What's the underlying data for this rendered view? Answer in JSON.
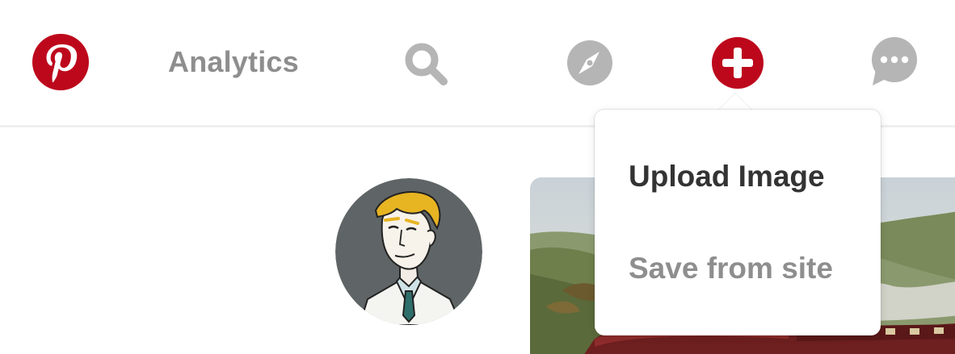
{
  "colors": {
    "brand_red": "#bd081c",
    "icon_gray": "#b5b5b5",
    "text_dark": "#333333",
    "text_gray": "#8e8e8e",
    "divider": "#efefef"
  },
  "header": {
    "logo_icon": "pinterest-logo-icon",
    "analytics_label": "Analytics",
    "search_icon": "search-icon",
    "explore_icon": "compass-icon",
    "add_icon": "plus-icon",
    "messages_icon": "speech-bubble-icon"
  },
  "add_menu": {
    "items": [
      {
        "label": "Upload Image"
      },
      {
        "label": "Save from site"
      }
    ]
  },
  "profile": {
    "avatar_icon": "cartoon-avatar"
  },
  "feed": {
    "pin_image": "steam-train-painting"
  }
}
